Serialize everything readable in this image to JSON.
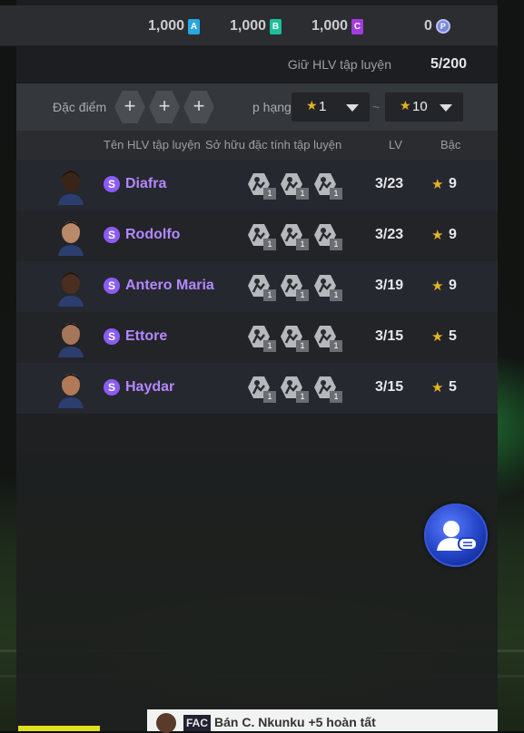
{
  "currencies": [
    {
      "value": "1,000",
      "letter": "A",
      "color": "#29a8e0"
    },
    {
      "value": "1,000",
      "letter": "B",
      "color": "#1bbf9a"
    },
    {
      "value": "1,000",
      "letter": "C",
      "color": "#a43be0"
    },
    {
      "value": "0",
      "letter": "P",
      "color": "#7a86d8"
    }
  ],
  "keep": {
    "label": "Giữ HLV tập luyện",
    "count": "5/200"
  },
  "filter": {
    "trait_label": "Đặc điểm c",
    "add_symbol": "+",
    "rank_label": "p hạng",
    "min_rank": "1",
    "tilde": "~",
    "max_rank": "10"
  },
  "columns": {
    "name": "Tên HLV tập luyện",
    "traits": "Sở hữu đặc tính tập luyện",
    "lv": "LV",
    "grade": "Bậc"
  },
  "coaches": [
    {
      "badge": "S",
      "name": "Diafra",
      "lv": "3/23",
      "grade": "9",
      "trait_levels": [
        "1",
        "1",
        "1"
      ],
      "icons": [
        "shield-trait-icon",
        "player-kick-icon",
        "dribble-trait-icon"
      ],
      "skin": "#3a2418"
    },
    {
      "badge": "S",
      "name": "Rodolfo",
      "lv": "3/23",
      "grade": "9",
      "trait_levels": [
        "1",
        "1",
        "1"
      ],
      "icons": [
        "jump-trait-icon",
        "tackle-trait-icon",
        "arrow-up-trait-icon"
      ],
      "skin": "#b98a6a"
    },
    {
      "badge": "S",
      "name": "Antero Maria",
      "lv": "3/19",
      "grade": "9",
      "trait_levels": [
        "1",
        "1",
        "1"
      ],
      "icons": [
        "jump-trait-icon",
        "pass-trait-icon",
        "gear-trait-icon"
      ],
      "skin": "#4a2e20"
    },
    {
      "badge": "S",
      "name": "Ettore",
      "lv": "3/15",
      "grade": "5",
      "trait_levels": [
        "1",
        "1",
        "1"
      ],
      "icons": [
        "jump-trait-icon",
        "ball-trait-icon",
        "stand-trait-icon"
      ],
      "skin": "#a6765a"
    },
    {
      "badge": "S",
      "name": "Haydar",
      "lv": "3/15",
      "grade": "5",
      "trait_levels": [
        "1",
        "1",
        "1"
      ],
      "icons": [
        "jump-trait-icon",
        "arrow-up-trait-icon",
        "star-player-trait-icon"
      ],
      "skin": "#b07a58"
    }
  ],
  "star_glyph": "★",
  "notification": {
    "logo": "FAC",
    "text": "Bán C. Nkunku +5 hoàn tất"
  }
}
